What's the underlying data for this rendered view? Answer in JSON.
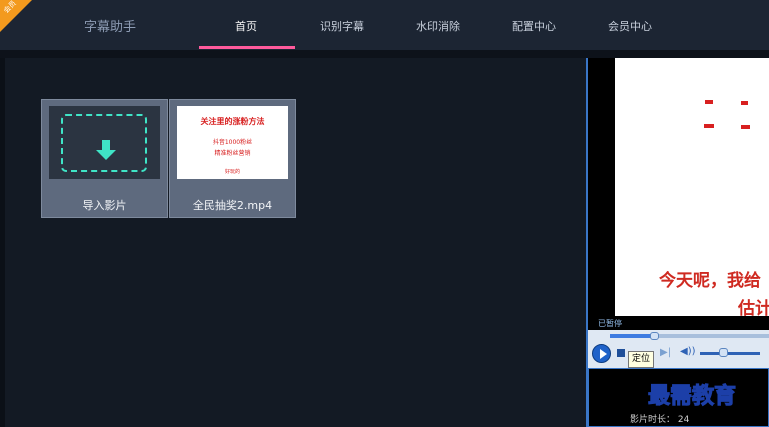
{
  "app": {
    "title": "字幕助手",
    "badge": "会员"
  },
  "nav": {
    "items": [
      {
        "label": "首页"
      },
      {
        "label": "识别字幕"
      },
      {
        "label": "水印消除"
      },
      {
        "label": "配置中心"
      },
      {
        "label": "会员中心"
      }
    ],
    "active_index": 0,
    "accent_color": "#ff5a9c"
  },
  "cards": {
    "import": {
      "label": "导入影片",
      "icon": "folder-download-icon",
      "icon_color": "#3fe4c6"
    },
    "video": {
      "label": "全民抽奖2.mp4",
      "thumb_title": "关注里的涨粉方法",
      "thumb_lines": [
        "抖音1000粉丝",
        "精准粉丝营销",
        "好玩的"
      ]
    }
  },
  "player": {
    "status": "已暂停",
    "subtitle_line1": "今天呢，我给",
    "subtitle_line2": "估计",
    "tooltip": "定位",
    "seek_position": 0.26,
    "volume": 0.32
  },
  "info": {
    "watermark": "最需教育",
    "duration_label": "影片时长：",
    "duration_value": "24"
  }
}
